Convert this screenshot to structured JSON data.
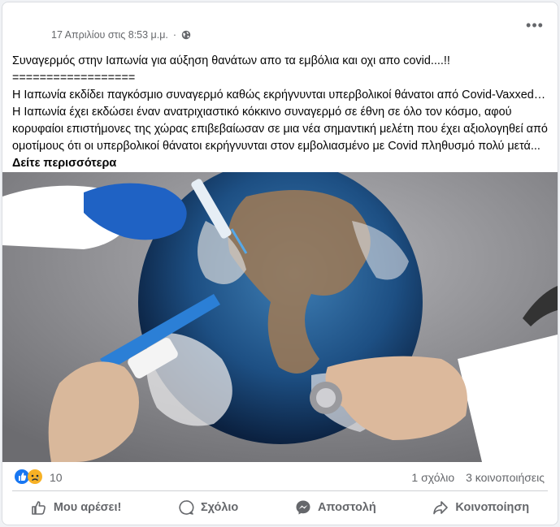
{
  "post": {
    "timestamp": "17 Απριλίου στις 8:53 μ.μ.",
    "separator": "·",
    "audience_icon": "globe-icon",
    "more_icon": "more-dots-icon",
    "more_label": "•••",
    "headline": "Συναγερμός στην Ιαπωνία για αύξηση θανάτων απο τα εμβόλια και οχι απο covid....!!",
    "rule": "==================",
    "body": "Η Ιαπωνία εκδίδει παγκόσμιο συναγερμό καθώς εκρήγνυνται υπερβολικοί θάνατοι από Covid-Vaxxed… Η Ιαπωνία έχει εκδώσει έναν ανατριχιαστικό κόκκινο συναγερμό σε έθνη σε όλο τον κόσμο, αφού κορυφαίοι επιστήμονες της χώρας επιβεβαίωσαν σε μια νέα σημαντική μελέτη που έχει αξιολογηθεί από ομοτίμους ότι οι υπερβολικοί θάνατοι εκρήγνυνται στον εμβολιασμένο με Covid πληθυσμό πολύ μετά...",
    "see_more": "Δείτε περισσότερα",
    "image_icon": "globe-vaccine-image"
  },
  "reactions": {
    "icons": [
      "like-icon",
      "sad-icon"
    ],
    "count": "10",
    "comments": "1 σχόλιο",
    "shares": "3 κοινοποιήσεις"
  },
  "actions": {
    "like": "Μου αρέσει!",
    "comment": "Σχόλιο",
    "send": "Αποστολή",
    "share": "Κοινοποίηση"
  },
  "colors": {
    "like_blue": "#1877f2",
    "sad_yellow": "#f7b125",
    "secondary_text": "#65676b"
  }
}
